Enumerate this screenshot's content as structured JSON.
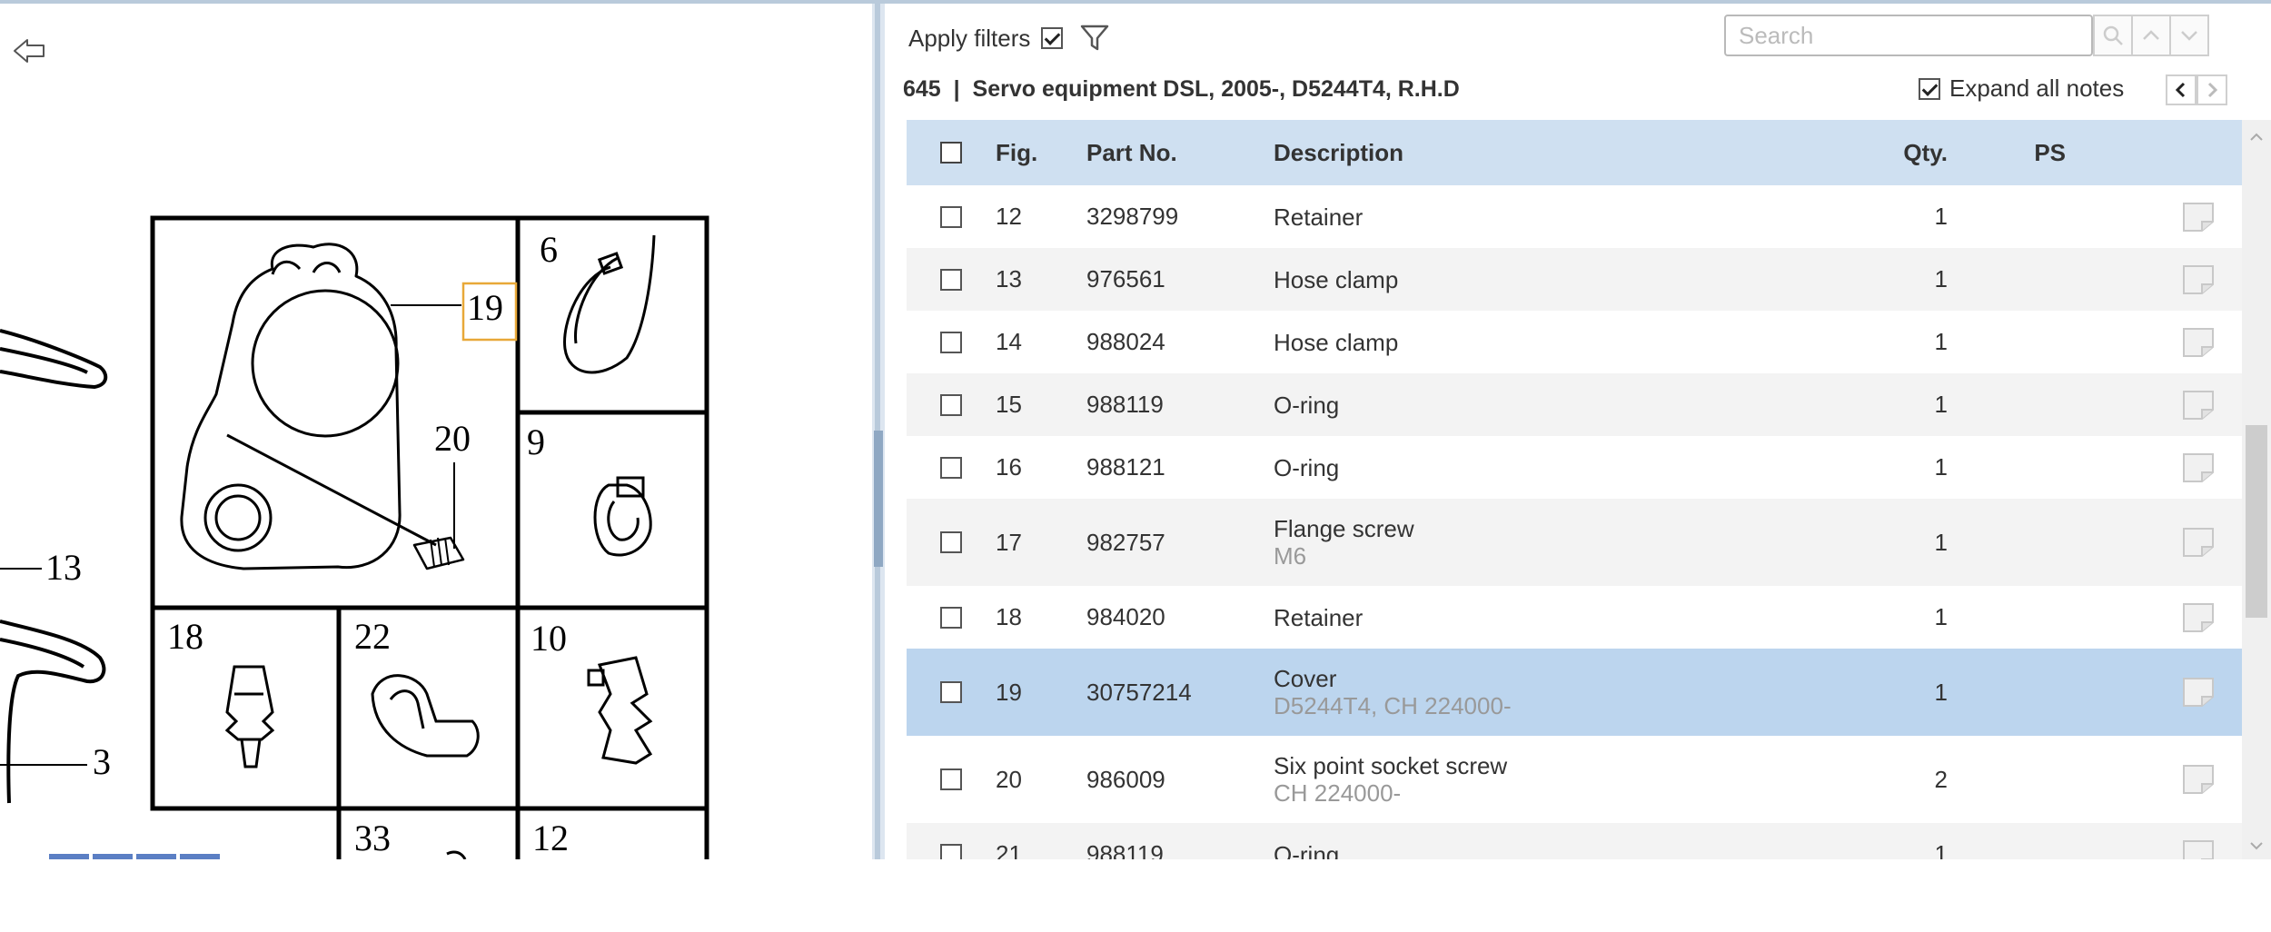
{
  "filters": {
    "apply_label": "Apply filters",
    "apply_checked": true
  },
  "search": {
    "placeholder": "Search"
  },
  "breadcrumb": {
    "section": "645",
    "separator": "|",
    "title": "Servo equipment DSL, 2005-, D5244T4, R.H.D"
  },
  "expand_notes": {
    "label": "Expand all notes",
    "checked": true
  },
  "table": {
    "headers": {
      "fig": "Fig.",
      "part_no": "Part No.",
      "description": "Description",
      "qty": "Qty.",
      "ps": "PS"
    },
    "rows": [
      {
        "fig": "12",
        "part_no": "3298799",
        "description": "Retainer",
        "note": "",
        "qty": "1"
      },
      {
        "fig": "13",
        "part_no": "976561",
        "description": "Hose clamp",
        "note": "",
        "qty": "1"
      },
      {
        "fig": "14",
        "part_no": "988024",
        "description": "Hose clamp",
        "note": "",
        "qty": "1"
      },
      {
        "fig": "15",
        "part_no": "988119",
        "description": "O-ring",
        "note": "",
        "qty": "1"
      },
      {
        "fig": "16",
        "part_no": "988121",
        "description": "O-ring",
        "note": "",
        "qty": "1"
      },
      {
        "fig": "17",
        "part_no": "982757",
        "description": "Flange screw",
        "note": "M6",
        "qty": "1"
      },
      {
        "fig": "18",
        "part_no": "984020",
        "description": "Retainer",
        "note": "",
        "qty": "1"
      },
      {
        "fig": "19",
        "part_no": "30757214",
        "description": "Cover",
        "note": "D5244T4, CH 224000-",
        "qty": "1",
        "selected": true
      },
      {
        "fig": "20",
        "part_no": "986009",
        "description": "Six point socket screw",
        "note": "CH 224000-",
        "qty": "2"
      },
      {
        "fig": "21",
        "part_no": "988119",
        "description": "O-ring",
        "note": "",
        "qty": "1"
      }
    ]
  },
  "illustration": {
    "callouts": [
      "19",
      "20",
      "6",
      "9",
      "13",
      "3",
      "18",
      "22",
      "10",
      "33",
      "12"
    ],
    "highlighted": "19"
  },
  "colors": {
    "header_bg": "#cfe0f1",
    "selected_row": "#bcd5ee",
    "alt_row": "#f3f3f3",
    "highlight_box": "#e8a838",
    "splitter": "#b9cadb"
  }
}
